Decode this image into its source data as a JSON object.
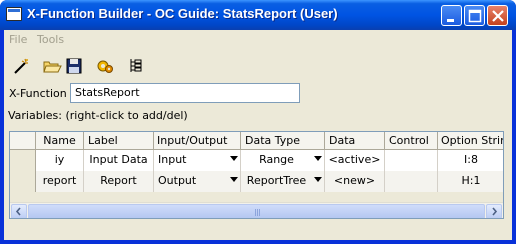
{
  "window": {
    "title": "X-Function Builder - OC Guide: StatsReport (User)"
  },
  "menu": {
    "items": [
      {
        "label": "File"
      },
      {
        "label": "Tools"
      }
    ]
  },
  "toolbar": {
    "icons": [
      "wand-icon",
      "open-folder-icon",
      "save-disk-icon",
      "compile-gear-icon",
      "tree-view-icon"
    ]
  },
  "form": {
    "xfunction_label": "X-Function",
    "xfunction_value": "StatsReport",
    "variables_label": "Variables: (right-click to add/del)"
  },
  "grid": {
    "columns": [
      "Name",
      "Label",
      "Input/Output",
      "Data Type",
      "Data",
      "Control",
      "Option String"
    ],
    "rows": [
      {
        "name": "iy",
        "label": "Input Data",
        "io": "Input",
        "type": "Range",
        "data": "<active>",
        "control": "",
        "option": "I:8"
      },
      {
        "name": "report",
        "label": "Report",
        "io": "Output",
        "type": "ReportTree",
        "data": "<new>",
        "control": "",
        "option": "H:1"
      }
    ]
  },
  "colors": {
    "titlebar": "#0054e3",
    "face": "#ece9d8",
    "input_border": "#7f9db9"
  }
}
